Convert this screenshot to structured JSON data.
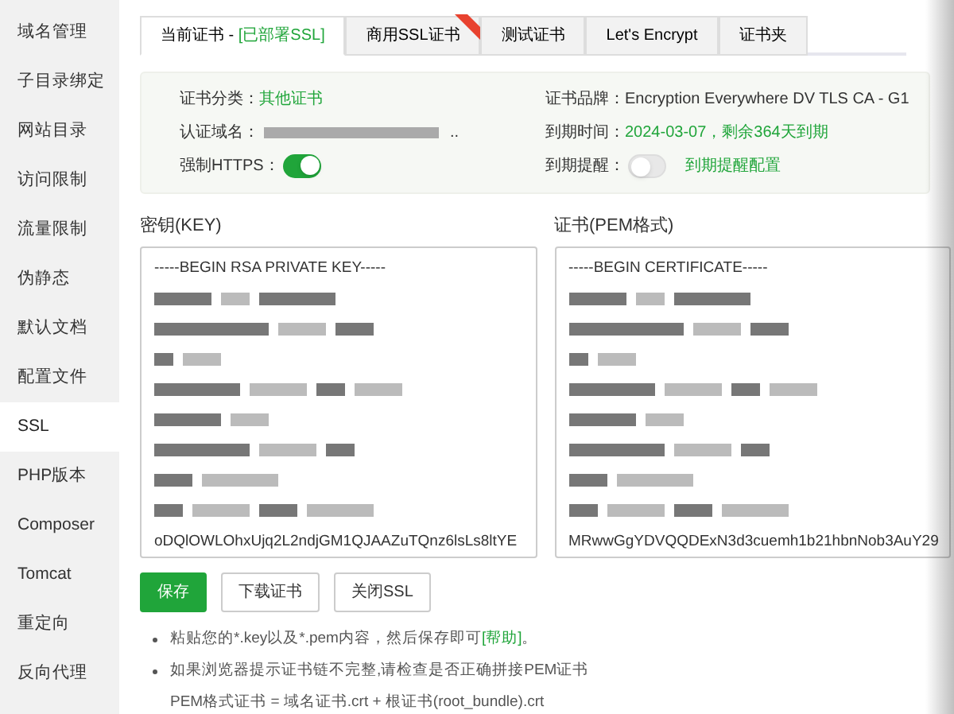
{
  "sidebar": {
    "items": [
      {
        "label": "域名管理",
        "selected": false
      },
      {
        "label": "子目录绑定",
        "selected": false
      },
      {
        "label": "网站目录",
        "selected": false
      },
      {
        "label": "访问限制",
        "selected": false
      },
      {
        "label": "流量限制",
        "selected": false
      },
      {
        "label": "伪静态",
        "selected": false
      },
      {
        "label": "默认文档",
        "selected": false
      },
      {
        "label": "配置文件",
        "selected": false
      },
      {
        "label": "SSL",
        "selected": true
      },
      {
        "label": "PHP版本",
        "selected": false
      },
      {
        "label": "Composer",
        "selected": false
      },
      {
        "label": "Tomcat",
        "selected": false
      },
      {
        "label": "重定向",
        "selected": false
      },
      {
        "label": "反向代理",
        "selected": false
      }
    ]
  },
  "tabs": [
    {
      "label": "当前证书 - ",
      "status": "[已部署SSL]",
      "selected": true,
      "ribbon": false
    },
    {
      "label": "商用SSL证书",
      "selected": false,
      "ribbon": true
    },
    {
      "label": "测试证书",
      "selected": false,
      "ribbon": false
    },
    {
      "label": "Let's Encrypt",
      "selected": false,
      "ribbon": false
    },
    {
      "label": "证书夹",
      "selected": false,
      "ribbon": false
    }
  ],
  "info": {
    "category_label": "证书分类：",
    "category": "其他证书",
    "domain_label": "认证域名：",
    "domain_suffix": "..",
    "force_https_label": "强制HTTPS：",
    "force_https": true,
    "brand_label": "证书品牌：",
    "brand": "Encryption Everywhere DV TLS CA - G1",
    "expiry_label": "到期时间：",
    "expiry": "2024-03-07，剩余364天到期",
    "reminder_label": "到期提醒：",
    "reminder": false,
    "reminder_link": "到期提醒配置"
  },
  "key": {
    "label": "密钥(KEY)",
    "lines": [
      {
        "kind": "text",
        "text": "-----BEGIN RSA PRIVATE KEY-----"
      },
      {
        "kind": "redacted"
      },
      {
        "kind": "redacted"
      },
      {
        "kind": "redacted"
      },
      {
        "kind": "redacted"
      },
      {
        "kind": "redacted"
      },
      {
        "kind": "redacted"
      },
      {
        "kind": "redacted"
      },
      {
        "kind": "redacted"
      },
      {
        "kind": "text",
        "text": "oDQlOWLOhxUjq2L2ndjGM1QJAAZuTQnz6lsLs8ltYE"
      }
    ]
  },
  "cert": {
    "label": "证书(PEM格式)",
    "lines": [
      {
        "kind": "text",
        "text": "-----BEGIN CERTIFICATE-----"
      },
      {
        "kind": "redacted"
      },
      {
        "kind": "redacted"
      },
      {
        "kind": "redacted"
      },
      {
        "kind": "redacted"
      },
      {
        "kind": "redacted"
      },
      {
        "kind": "redacted"
      },
      {
        "kind": "redacted"
      },
      {
        "kind": "redacted"
      },
      {
        "kind": "text",
        "text": "MRwwGgYDVQQDExN3d3cuemh1b21hbnNob3AuY29"
      }
    ]
  },
  "buttons": [
    {
      "label": "保存",
      "kind": "primary"
    },
    {
      "label": "下载证书",
      "kind": "default"
    },
    {
      "label": "关闭SSL",
      "kind": "default"
    }
  ],
  "tips": [
    {
      "text": "粘贴您的*.key以及*.pem内容，然后保存即可",
      "link": "[帮助]",
      "end": "。",
      "bullet": true
    },
    {
      "text": "如果浏览器提示证书链不完整,请检查是否正确拼接PEM证书",
      "bullet": true
    },
    {
      "text": "PEM格式证书 = 域名证书.crt + 根证书(root_bundle).crt",
      "bullet": false
    }
  ]
}
